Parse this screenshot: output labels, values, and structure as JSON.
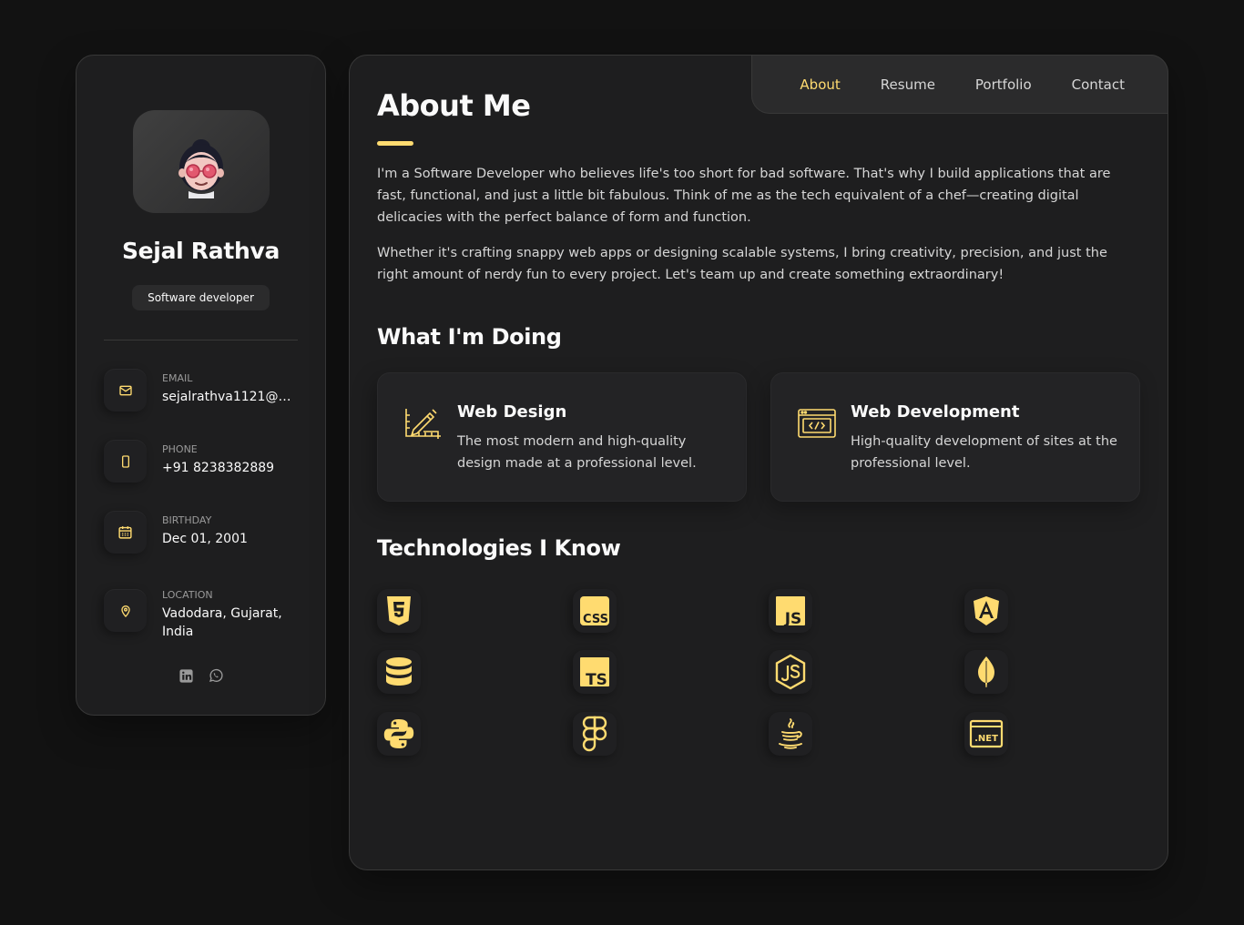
{
  "profile": {
    "name": "Sejal Rathva",
    "title": "Software developer"
  },
  "contacts": [
    {
      "label": "Email",
      "value": "sejalrathva1121@gm...",
      "icon": "mail-icon"
    },
    {
      "label": "Phone",
      "value": "+91 8238382889",
      "icon": "phone-icon"
    },
    {
      "label": "Birthday",
      "value": "Dec 01, 2001",
      "icon": "calendar-icon"
    },
    {
      "label": "Location",
      "value": "Vadodara, Gujarat, India",
      "icon": "location-icon"
    }
  ],
  "socials": [
    "linkedin-icon",
    "whatsapp-icon"
  ],
  "nav": {
    "items": [
      "About",
      "Resume",
      "Portfolio",
      "Contact"
    ],
    "active": "About"
  },
  "about": {
    "heading": "About Me",
    "paragraph1": "I'm a Software Developer who believes life's too short for bad software. That's why I build applications that are fast, functional, and just a little bit fabulous. Think of me as the tech equivalent of a chef—creating digital delicacies with the perfect balance of form and function.",
    "paragraph2": "Whether it's crafting snappy web apps or designing scalable systems, I bring creativity, precision, and just the right amount of nerdy fun to every project. Let's team up and create something extraordinary!"
  },
  "services": {
    "heading": "What I'm Doing",
    "items": [
      {
        "title": "Web Design",
        "text": "The most modern and high-quality design made at a professional level.",
        "icon": "design-icon"
      },
      {
        "title": "Web Development",
        "text": "High-quality development of sites at the professional level.",
        "icon": "code-window-icon"
      }
    ]
  },
  "technologies": {
    "heading": "Technologies I Know",
    "icons": [
      "html5-icon",
      "css-icon",
      "javascript-icon",
      "angular-icon",
      "database-icon",
      "typescript-icon",
      "nodejs-icon",
      "mongodb-icon",
      "python-icon",
      "figma-icon",
      "java-icon",
      "dotnet-icon"
    ],
    "labels": {
      "css": "CSS",
      "js": "JS",
      "ts": "TS",
      "net": ".NET"
    }
  },
  "colors": {
    "accent": "#ffdb70",
    "background": "#121212",
    "card": "#1e1e1f"
  }
}
